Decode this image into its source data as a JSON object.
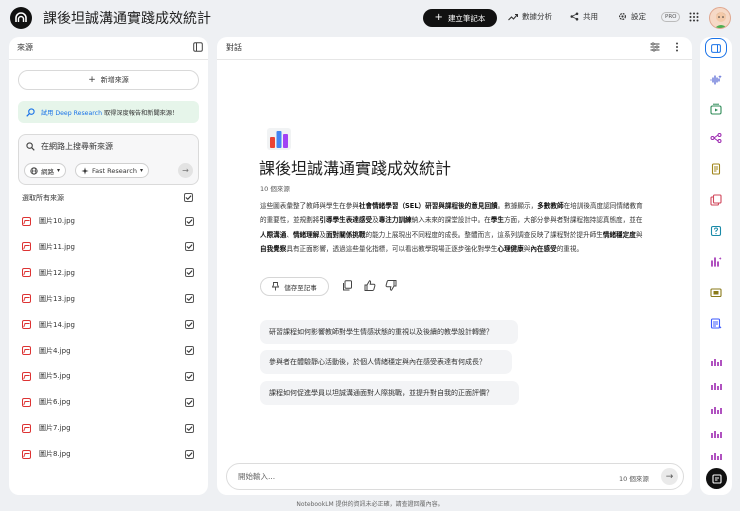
{
  "app": {
    "title": "課後坦誠溝通實踐成效統計",
    "create_notebook_label": "建立筆記本",
    "analytics_label": "數據分析",
    "share_label": "共用",
    "settings_label": "設定",
    "pro_badge": "PRO"
  },
  "sources_panel": {
    "title": "來源",
    "add_source_label": "新增來源",
    "deep_research_link": "試用 Deep Research",
    "deep_research_text": "取得深度報告和新聞來源！",
    "search_placeholder": "在網路上搜尋新來源",
    "chip_web": "網路",
    "chip_research": "Fast Research",
    "select_all_label": "選取所有來源",
    "items": [
      {
        "name": "圖片10.jpg",
        "checked": true
      },
      {
        "name": "圖片11.jpg",
        "checked": true
      },
      {
        "name": "圖片12.jpg",
        "checked": true
      },
      {
        "name": "圖片13.jpg",
        "checked": true
      },
      {
        "name": "圖片14.jpg",
        "checked": true
      },
      {
        "name": "圖片4.jpg",
        "checked": true
      },
      {
        "name": "圖片5.jpg",
        "checked": true
      },
      {
        "name": "圖片6.jpg",
        "checked": true
      },
      {
        "name": "圖片7.jpg",
        "checked": true
      },
      {
        "name": "圖片8.jpg",
        "checked": true
      }
    ]
  },
  "chat_panel": {
    "title": "對話",
    "notebook_title": "課後坦誠溝通實踐成效統計",
    "source_count": "10 個來源",
    "summary_parts": [
      {
        "t": "這些圖表彙整了教師與學生在參與",
        "b": false
      },
      {
        "t": "社會情緒學習（SEL）研習與課程後的意見回饋",
        "b": true
      },
      {
        "t": "。數據顯示，",
        "b": false
      },
      {
        "t": "多數教師",
        "b": true
      },
      {
        "t": "在培訓後高度認同情緒教育的重要性，並規劃將",
        "b": false
      },
      {
        "t": "引導學生表達感受",
        "b": true
      },
      {
        "t": "及",
        "b": false
      },
      {
        "t": "專注力訓練",
        "b": true
      },
      {
        "t": "納入未來的課堂設計中。在",
        "b": false
      },
      {
        "t": "學生",
        "b": true
      },
      {
        "t": "方面，大部分參與者對課程抱持認真態度，並在",
        "b": false
      },
      {
        "t": "人際溝通",
        "b": true
      },
      {
        "t": "、",
        "b": false
      },
      {
        "t": "情緒理解",
        "b": true
      },
      {
        "t": "及",
        "b": false
      },
      {
        "t": "面對關係挑戰",
        "b": true
      },
      {
        "t": "的能力上展現出不同程度的成長。整體而言，這系列調查反映了課程對於提升師生",
        "b": false
      },
      {
        "t": "情緒穩定度",
        "b": true
      },
      {
        "t": "與",
        "b": false
      },
      {
        "t": "自我覺察",
        "b": true
      },
      {
        "t": "具有正面影響，透過這些量化指標，可以看出教學現場正逐步強化對學生",
        "b": false
      },
      {
        "t": "心理健康",
        "b": true
      },
      {
        "t": "與",
        "b": false
      },
      {
        "t": "內在感受",
        "b": true
      },
      {
        "t": "的重視。",
        "b": false
      }
    ],
    "save_note_label": "儲存至記事",
    "suggested_questions": [
      "研習課程如何影響教師對學生情感狀態的重視以及後續的教學設計轉變？",
      "參與者在體驗靜心活動後，於個人情緒穩定與內在感受表達有何成長？",
      "課程如何促進學員以坦誠溝通面對人際挑戰，並提升對自我的正面評價？"
    ],
    "input_placeholder": "開始輸入...",
    "input_source_count": "10 個來源"
  },
  "footer_text": "NotebookLM 提供的資訊未必正確，請查證回覆內容。"
}
